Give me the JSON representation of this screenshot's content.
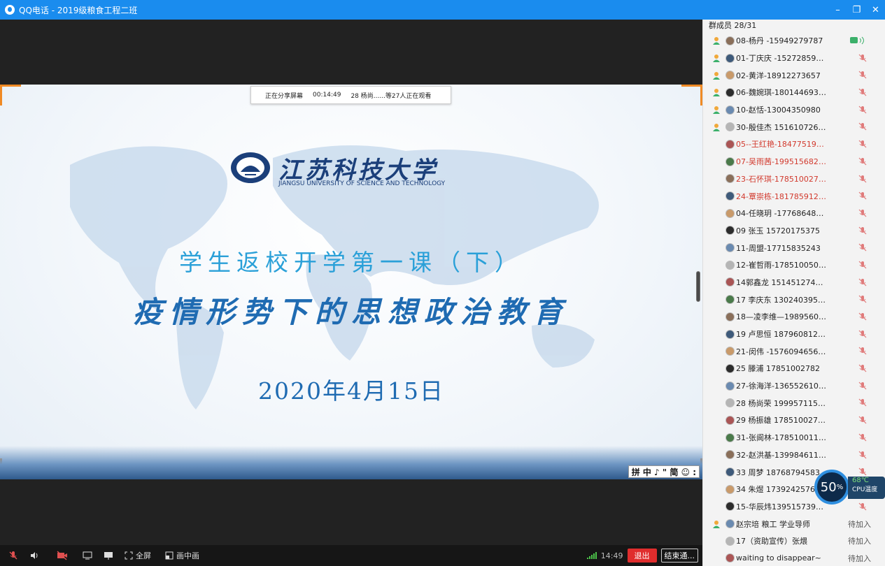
{
  "window": {
    "title": "QQ电话 - 2019级粮食工程二班",
    "controls": {
      "minimize": "–",
      "restore": "❐",
      "close": "✕"
    }
  },
  "share": {
    "status": "正在分享屏幕",
    "elapsed": "00:14:49",
    "viewers": "28  杨尚......等27人正在观看"
  },
  "slide": {
    "university_cn": "江苏科技大学",
    "university_en": "JIANGSU UNIVERSITY OF SCIENCE AND TECHNOLOGY",
    "subtitle": "学生返校开学第一课（下）",
    "title": "疫情形势下的思想政治教育",
    "date": "2020年4月15日",
    "ime": "拼 中 ♪ \" 简 ☺ :"
  },
  "toolbar": {
    "fullscreen": "全屏",
    "pip": "画中画",
    "time": "14:49",
    "exit": "退出",
    "end": "结束通..."
  },
  "panel": {
    "header": "群成员 28/31",
    "members": [
      {
        "name": "08-杨丹 -15949279787",
        "role": true,
        "state": "speaking",
        "red": false
      },
      {
        "name": "01-丁庆庆  -152728599...",
        "role": true,
        "state": "muted",
        "red": false
      },
      {
        "name": "02-黄洋-18912273657",
        "role": true,
        "state": "muted",
        "red": false
      },
      {
        "name": "06-魏婉琪-1801446936...",
        "role": true,
        "state": "muted",
        "red": false
      },
      {
        "name": "10-赵恬-13004350980",
        "role": true,
        "state": "muted",
        "red": false
      },
      {
        "name": "30-殷佳杰 1516107263...",
        "role": true,
        "state": "muted",
        "red": false
      },
      {
        "name": "05--王红艳-1847751928...",
        "role": false,
        "state": "muted",
        "red": true
      },
      {
        "name": "07-吴雨茜-1995156824...",
        "role": false,
        "state": "muted",
        "red": true
      },
      {
        "name": "23-石怀琪-1785100276...",
        "role": false,
        "state": "muted",
        "red": true
      },
      {
        "name": "24-覃崇栋-1817859128...",
        "role": false,
        "state": "muted",
        "red": true
      },
      {
        "name": "04-任晓玥  -177686481...",
        "role": false,
        "state": "muted",
        "red": false
      },
      {
        "name": "09 张玉 15720175375",
        "role": false,
        "state": "muted",
        "red": false
      },
      {
        "name": "11-周盟-17715835243",
        "role": false,
        "state": "muted",
        "red": false
      },
      {
        "name": "12-崔哲雨-1785100506...",
        "role": false,
        "state": "muted",
        "red": false
      },
      {
        "name": "14郭鑫龙  1514512740...",
        "role": false,
        "state": "muted",
        "red": false
      },
      {
        "name": "17 李庆东 13024039547...",
        "role": false,
        "state": "muted",
        "red": false
      },
      {
        "name": "18—凌李维—19895605...",
        "role": false,
        "state": "muted",
        "red": false
      },
      {
        "name": "19 卢思恒 18796081275...",
        "role": false,
        "state": "muted",
        "red": false
      },
      {
        "name": "21-闵伟  -15760946565...",
        "role": false,
        "state": "muted",
        "red": false
      },
      {
        "name": "25 滕浦 17851002782",
        "role": false,
        "state": "muted",
        "red": false
      },
      {
        "name": "27-徐海洋-1365526109...",
        "role": false,
        "state": "muted",
        "red": false
      },
      {
        "name": "28  杨尚荣  199957115C...",
        "role": false,
        "state": "muted",
        "red": false
      },
      {
        "name": "29 杨振雄 1785100278C...",
        "role": false,
        "state": "muted",
        "red": false
      },
      {
        "name": "31-张阆林-1785100117...",
        "role": false,
        "state": "muted",
        "red": false
      },
      {
        "name": "32-赵洪基-1399846112...",
        "role": false,
        "state": "muted",
        "red": false
      },
      {
        "name": "33 周梦 18768794583",
        "role": false,
        "state": "muted",
        "red": false
      },
      {
        "name": "34 朱煜   17392425767",
        "role": false,
        "state": "muted",
        "red": false
      },
      {
        "name": "15-华辰炜13951573928...",
        "role": false,
        "state": "muted",
        "red": false
      },
      {
        "name": "赵宗培 粮工 学业导师",
        "role": true,
        "state": "waiting",
        "red": false
      },
      {
        "name": "17（资助宣传）张煨",
        "role": false,
        "state": "waiting",
        "red": false
      },
      {
        "name": "waiting to disappear~",
        "role": false,
        "state": "waiting",
        "red": false
      }
    ],
    "waiting_label": "待加入"
  },
  "cpu": {
    "usage": "50",
    "usage_unit": "%",
    "temp": "68℃",
    "label": "CPU温度"
  },
  "colors": {
    "titlebar": "#1a8cee",
    "slide_title": "#1f6bb2",
    "exit": "#e02d2d",
    "mute_icon": "#e07a7a",
    "red_name": "#d23a2e"
  }
}
